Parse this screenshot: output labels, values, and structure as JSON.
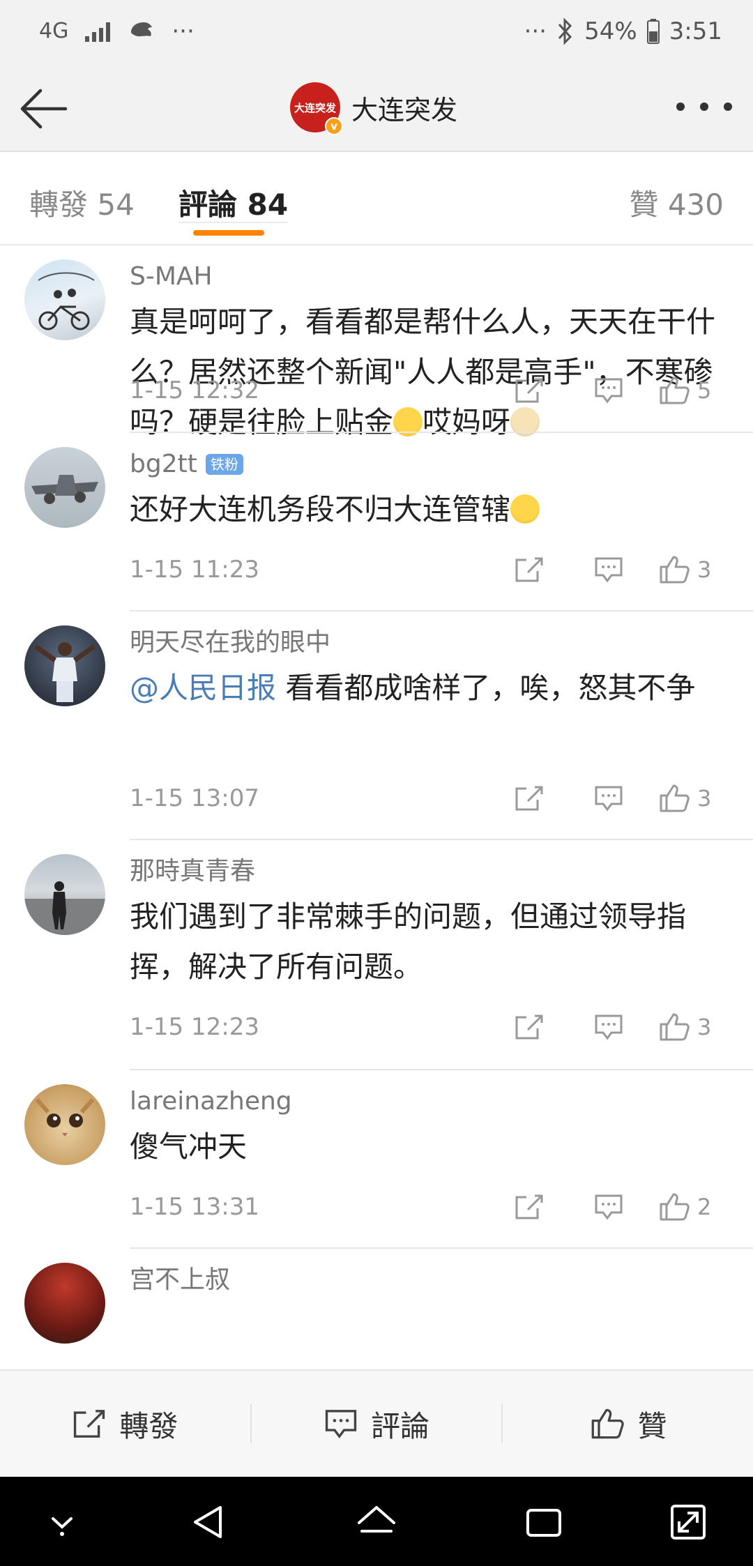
{
  "status_bar": {
    "network": "4G",
    "dots": "···",
    "battery": "54%",
    "time": "3:51"
  },
  "header": {
    "title": "大连突发",
    "avatar_text": "大连突发"
  },
  "tabs": {
    "repost": "轉發 54",
    "comment": "評論 84",
    "like": "贊 430"
  },
  "comments": [
    {
      "user": "S-MAH",
      "text_before": "真是呵呵了，看看都是帮什么人，天天在干什么？居然还整个新闻\"人人都是高手\"，不寒碜吗？硬是往脸上贴金",
      "text_after": "哎妈呀",
      "time": "1-15 12:32",
      "likes": "5"
    },
    {
      "user": "bg2tt",
      "badge": "铁粉",
      "text_before": "还好大连机务段不归大连管辖",
      "time": "1-15 11:23",
      "likes": "3"
    },
    {
      "user": "明天尽在我的眼中",
      "mention": "@人民日报",
      "text_after_mention": " 看看都成啥样了，唉，怒其不争",
      "time": "1-15 13:07",
      "likes": "3"
    },
    {
      "user": "那時真青春",
      "text_before": "我们遇到了非常棘手的问题，但通过领导指挥，解决了所有问题。",
      "time": "1-15 12:23",
      "likes": "3"
    },
    {
      "user": "lareinazheng",
      "text_before": "傻气冲天",
      "time": "1-15 13:31",
      "likes": "2"
    },
    {
      "user": "宫不上叔"
    }
  ],
  "bottom_bar": {
    "repost": "轉發",
    "comment": "評論",
    "like": "贊"
  },
  "colors": {
    "accent": "#ff8200",
    "mention": "#4a7cb8",
    "brand_red": "#c8201c"
  }
}
